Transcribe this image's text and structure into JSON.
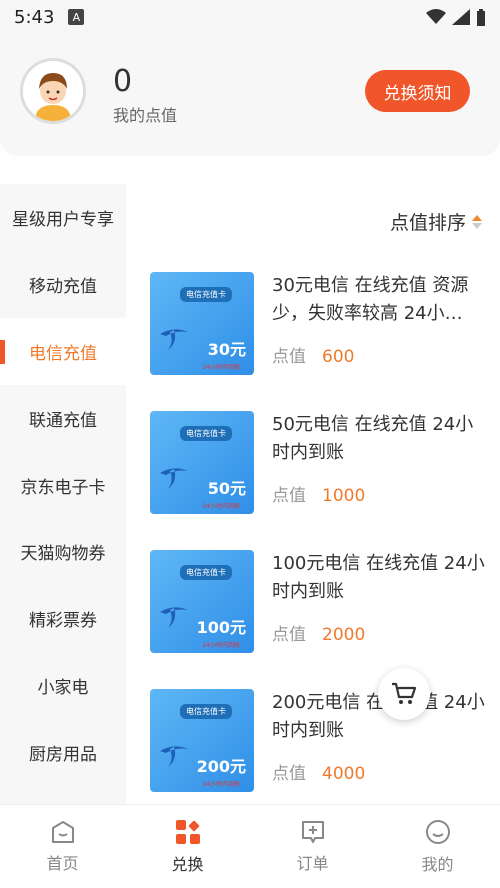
{
  "status_bar": {
    "time": "5:43",
    "badge": "A"
  },
  "header": {
    "points_value": "0",
    "points_label": "我的点值",
    "notice_button": "兑换须知"
  },
  "sidebar": {
    "items": [
      {
        "label": "星级用户专享"
      },
      {
        "label": "移动充值"
      },
      {
        "label": "电信充值"
      },
      {
        "label": "联通充值"
      },
      {
        "label": "京东电子卡"
      },
      {
        "label": "天猫购物券"
      },
      {
        "label": "精彩票券"
      },
      {
        "label": "小家电"
      },
      {
        "label": "厨房用品"
      }
    ],
    "active_index": 2
  },
  "sort": {
    "label": "点值排序"
  },
  "products": [
    {
      "thumb_tag": "电信充值卡",
      "thumb_price": "30元",
      "thumb_note": "24小时内到账",
      "title": "30元电信 在线充值 资源少，失败率较高 24小…",
      "points_label": "点值",
      "points": "600"
    },
    {
      "thumb_tag": "电信充值卡",
      "thumb_price": "50元",
      "thumb_note": "24小时内到账",
      "title": "50元电信 在线充值 24小时内到账",
      "points_label": "点值",
      "points": "1000"
    },
    {
      "thumb_tag": "电信充值卡",
      "thumb_price": "100元",
      "thumb_note": "24小时内到账",
      "title": "100元电信 在线充值 24小时内到账",
      "points_label": "点值",
      "points": "2000"
    },
    {
      "thumb_tag": "电信充值卡",
      "thumb_price": "200元",
      "thumb_note": "24小时内到账",
      "title": "200元电信 在线充值 24小时内到账",
      "points_label": "点值",
      "points": "4000"
    }
  ],
  "tabbar": {
    "tabs": [
      {
        "label": "首页",
        "icon": "home-icon"
      },
      {
        "label": "兑换",
        "icon": "exchange-icon"
      },
      {
        "label": "订单",
        "icon": "order-icon"
      },
      {
        "label": "我的",
        "icon": "profile-icon"
      }
    ],
    "active_index": 1
  },
  "colors": {
    "accent": "#f0562a",
    "points": "#f07a2b",
    "active_sidebar": "#f07a2b"
  }
}
